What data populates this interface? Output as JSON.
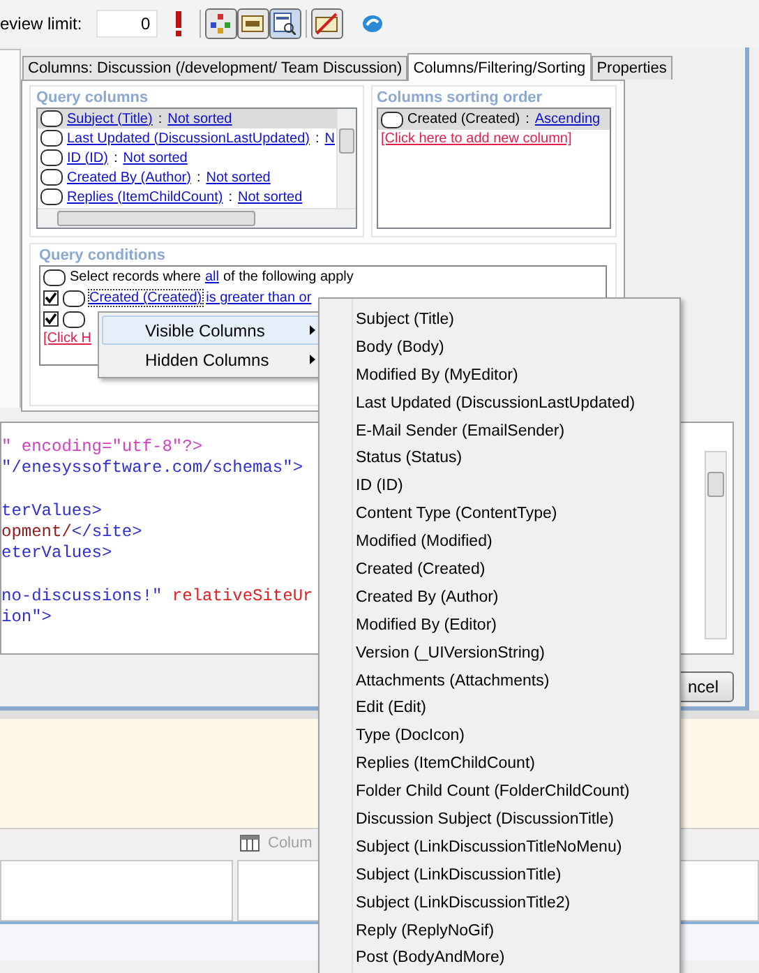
{
  "toolbar": {
    "limit_label": "eview limit:",
    "limit_value": "0"
  },
  "tabs": [
    {
      "label": "Columns: Discussion (/development/ Team Discussion)",
      "selected": false
    },
    {
      "label": "Columns/Filtering/Sorting",
      "selected": true
    },
    {
      "label": "Properties",
      "selected": false
    }
  ],
  "query_columns": {
    "title": "Query columns",
    "rows": [
      {
        "name": "Subject (Title)",
        "separator": ":",
        "sort": "Not sorted",
        "selected": true
      },
      {
        "name": "Last Updated (DiscussionLastUpdated)",
        "separator": ":",
        "sort": "N",
        "selected": false
      },
      {
        "name": "ID (ID)",
        "separator": ":",
        "sort": "Not sorted",
        "selected": false
      },
      {
        "name": "Created By (Author)",
        "separator": ":",
        "sort": "Not sorted",
        "selected": false
      },
      {
        "name": "Replies (ItemChildCount)",
        "separator": ":",
        "sort": "Not sorted",
        "selected": false
      }
    ]
  },
  "sorting_order": {
    "title": "Columns sorting order",
    "rows": [
      {
        "name": "Created (Created)",
        "separator": ":",
        "order": "Ascending",
        "selected": true
      }
    ],
    "add_link": "[Click here to add new column]"
  },
  "query_conditions": {
    "title": "Query conditions",
    "header": {
      "prefix": "Select records where",
      "mode": "all",
      "suffix": "of the following apply"
    },
    "rows": [
      {
        "checked": true,
        "field": "Created (Created)",
        "operator": "is greater than or"
      },
      {
        "checked": true
      }
    ],
    "add_link": "[Click H"
  },
  "xml_lines": [
    {
      "blank_before": false,
      "segments": [
        {
          "kind": "attr",
          "text": "\" encoding=\"utf-8\"?>"
        }
      ]
    },
    {
      "blank_before": false,
      "segments": [
        {
          "kind": "tag",
          "text": "\"/enesyssoftware.com/schemas\">"
        }
      ]
    },
    {
      "blank_before": true,
      "segments": [
        {
          "kind": "tag",
          "text": "terValues>"
        }
      ]
    },
    {
      "blank_before": false,
      "segments": [
        {
          "kind": "text",
          "text": "opment/"
        },
        {
          "kind": "tag",
          "text": "</site>"
        }
      ]
    },
    {
      "blank_before": false,
      "segments": [
        {
          "kind": "tag",
          "text": "eterValues>"
        }
      ]
    },
    {
      "blank_before": true,
      "segments": [
        {
          "kind": "tag",
          "text": "no-discussions!\" "
        },
        {
          "kind": "name",
          "text": "relativeSiteUr"
        }
      ]
    },
    {
      "blank_before": false,
      "segments": [
        {
          "kind": "tag",
          "text": "ion\">"
        }
      ]
    }
  ],
  "cancel_button": "ncel",
  "bottom_toolbar": {
    "label": "Colum"
  },
  "context_menu": [
    {
      "label": "Visible Columns",
      "selected": true
    },
    {
      "label": "Hidden Columns",
      "selected": false
    }
  ],
  "submenu": [
    "Subject (Title)",
    "Body (Body)",
    "Modified By (MyEditor)",
    "Last Updated (DiscussionLastUpdated)",
    "E-Mail Sender (EmailSender)",
    "Status (Status)",
    "ID (ID)",
    "Content Type (ContentType)",
    "Modified (Modified)",
    "Created (Created)",
    "Created By (Author)",
    "Modified By (Editor)",
    "Version (_UIVersionString)",
    "Attachments (Attachments)",
    "Edit (Edit)",
    "Type (DocIcon)",
    "Replies (ItemChildCount)",
    "Folder Child Count (FolderChildCount)",
    "Discussion Subject (DiscussionTitle)",
    "Subject (LinkDiscussionTitleNoMenu)",
    "Subject (LinkDiscussionTitle)",
    "Subject (LinkDiscussionTitle2)",
    "Reply (ReplyNoGif)",
    "Post (BodyAndMore)"
  ]
}
